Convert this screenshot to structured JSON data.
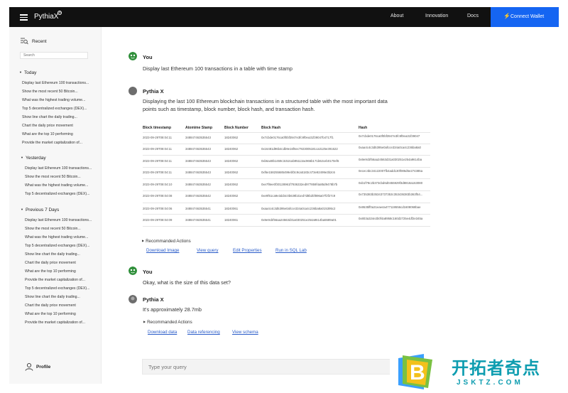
{
  "app": {
    "brand": "PythiaX",
    "brand_sup": "®",
    "nav": [
      "About",
      "Innovation",
      "Docs"
    ],
    "connect_label": "Connect Wallet",
    "accent": "#1565f2"
  },
  "sidebar": {
    "recent_label": "Recent",
    "search_placeholder": "Search",
    "groups": [
      {
        "label": "Today",
        "items": [
          "Display last Ethereum 100 transactions...",
          "Show the most recent 50 Bitcoin...",
          "What was the highest trading volume...",
          "Top 5 decentralized exchanges (DEX)...",
          "Show line chart the daily trading...",
          "Chart the daily price movement",
          "What are the top 10 performing",
          "Provide the market capitalization of..."
        ]
      },
      {
        "label": "Yesterday",
        "items": [
          "Display last Ethereum 100 transactions...",
          "Show the most recent 50 Bitcoin...",
          "What was the highest trading volume...",
          "Top 5 decentralized exchanges (DEX)..."
        ]
      },
      {
        "label": "Previous 7 Days",
        "items": [
          "Display last Ethereum 100 transactions...",
          "Show the most recent 50 Bitcoin...",
          "What was the highest trading volume...",
          "Top 5 decentralized exchanges (DEX)...",
          "Show line chart the daily trading...",
          "Chart the daily price movement",
          "What are the top 10 performing",
          "Provide the market capitalization of...",
          "Top 5 decentralized exchanges (DEX)...",
          "Show line chart the daily trading...",
          "Chart the daily price movement",
          "What are the top 10 performing",
          "Provide the market capitalization of..."
        ]
      }
    ],
    "profile_label": "Profile"
  },
  "chat": {
    "msg1": {
      "sender": "You",
      "text": "Display last Ethereum 100 transactions in a table with time stamp"
    },
    "msg2": {
      "sender": "Pythia X",
      "line1": "Displaying the last 100 Ethereum blockchain transactions in a structured table with the most important data",
      "line2": "points such as timestamp, block number, block hash, and transaction hash."
    },
    "table": {
      "headers": [
        "Block timestamp",
        "Atomime Stamp",
        "Block Number",
        "Block Hash",
        "Hash"
      ],
      "rows": [
        [
          "2023-09-29T08:04:11",
          "348847463535543",
          "18240062",
          "0x7cbde0176ca0f0bf3947e3fc9f0ea31f39047b4717f1",
          "0x7cbde0176ca0f0bf3947e3fc9f0ea31f39047"
        ],
        [
          "2023-09-29T08:04:11",
          "348847463535543",
          "18240062",
          "0x16481d96b4cdb9e16f6ec7923005181ca3125e391622",
          "0xaa4c4c3d5395e0afcce334a0ca4c236ba8a0"
        ],
        [
          "2023-09-29T08:04:11",
          "348847463535543",
          "18240062",
          "0xb6a48b1459c3c52cab95113ac966b171b62ceb0170ef6",
          "0x9e9cbf56aa24563d31a030251e254a9614ba"
        ],
        [
          "2023-09-29T08:04:11",
          "348847463535543",
          "18240062",
          "0xf6e158255685499ebf3c9ca5183c473e92499e3b2c6",
          "0ecec4bc34122007fb4add130f086d5e274385a"
        ],
        [
          "2023-09-29T08:04:10",
          "348847463535542",
          "18240062",
          "0xe7f8ee0f30128961f7936332ed977859f4a85d9478b7b",
          "0xb1f78c2b373cbd6d0455929f3d8818a163080"
        ],
        [
          "2023-09-29T08:04:08",
          "348847463535542",
          "18240062",
          "0xe9f61ca9e3dd4c0b639b31ed7d8b2bf896a07f2f27c9",
          "0x735383b35343737353c353436383b363f54..."
        ],
        [
          "2023-09-29T08:04:06",
          "348847463535541",
          "18240061",
          "0xaa4c4c3d5395e0afcce334a0ca4c236ba8a015395c2",
          "0x9535ff0a31eae4a477119556cd1608068bae"
        ],
        [
          "2023-09-29T08:04:09",
          "348847463535541",
          "18240061",
          "0x9e9cbf56aa24563d31a030251e254a9614ba5589a01",
          "0x803a324e2b0f4a8958c160d2725e4df2e345a"
        ]
      ]
    },
    "rec1": {
      "label": "Recommanded Actions",
      "links": [
        "Download Image",
        "View query",
        "Edit Properties",
        "Run in SQL Lab"
      ]
    },
    "msg3": {
      "sender": "You",
      "text": "Okay, what is the size of this data set?"
    },
    "msg4": {
      "sender": "Pythia X",
      "text": "It's approximately 28.7mb"
    },
    "rec2": {
      "label": "Recommanded Actions",
      "links": [
        "Download data",
        "Data referencing",
        "View schema"
      ]
    },
    "input_placeholder": "Type your query"
  },
  "watermark": {
    "logo_letter": "B",
    "title": "开拓者奇点",
    "url": "JSKTZ.COM"
  }
}
